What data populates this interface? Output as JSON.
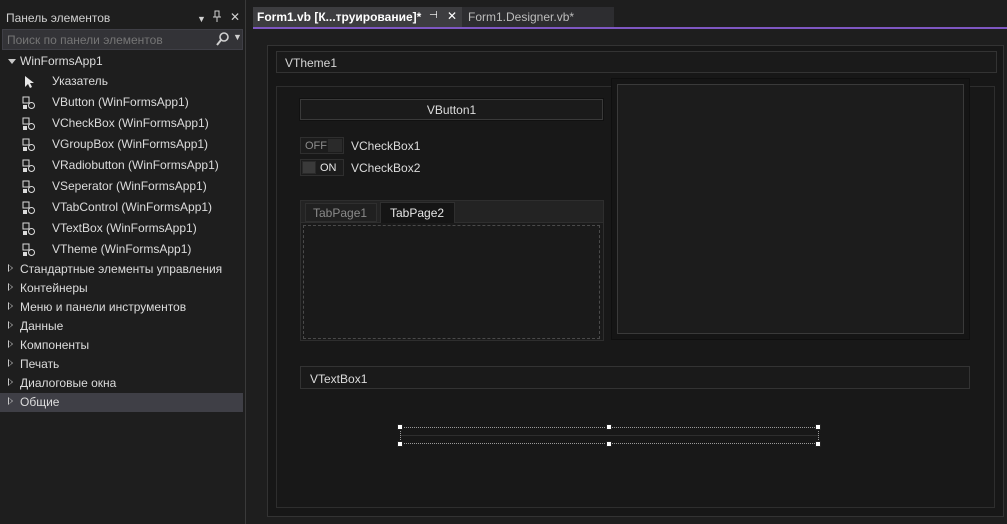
{
  "toolbox": {
    "title": "Панель элементов",
    "search_placeholder": "Поиск по панели элементов",
    "project_group": "WinFormsApp1",
    "items": [
      {
        "label": "Указатель"
      },
      {
        "label": "VButton (WinFormsApp1)"
      },
      {
        "label": "VCheckBox (WinFormsApp1)"
      },
      {
        "label": "VGroupBox (WinFormsApp1)"
      },
      {
        "label": "VRadiobutton (WinFormsApp1)"
      },
      {
        "label": "VSeperator (WinFormsApp1)"
      },
      {
        "label": "VTabControl (WinFormsApp1)"
      },
      {
        "label": "VTextBox (WinFormsApp1)"
      },
      {
        "label": "VTheme (WinFormsApp1)"
      }
    ],
    "groups": [
      {
        "label": "Стандартные элементы управления"
      },
      {
        "label": "Контейнеры"
      },
      {
        "label": "Меню и панели инструментов"
      },
      {
        "label": "Данные"
      },
      {
        "label": "Компоненты"
      },
      {
        "label": "Печать"
      },
      {
        "label": "Диалоговые окна"
      },
      {
        "label": "Общие"
      }
    ]
  },
  "tabs": {
    "active": "Form1.vb [К...труирование]*",
    "second": "Form1.Designer.vb*"
  },
  "designer": {
    "theme_title": "VTheme1",
    "button_text": "VButton1",
    "checkbox1": {
      "state": "OFF",
      "label": "VCheckBox1"
    },
    "checkbox2": {
      "state": "ON",
      "label": "VCheckBox2"
    },
    "tabpages": [
      "TabPage1",
      "TabPage2"
    ],
    "textbox_text": "VTextBox1"
  },
  "colors": {
    "accent": "#7e57c2",
    "background": "#1e1e1e",
    "selected_row": "#3f3f46"
  }
}
